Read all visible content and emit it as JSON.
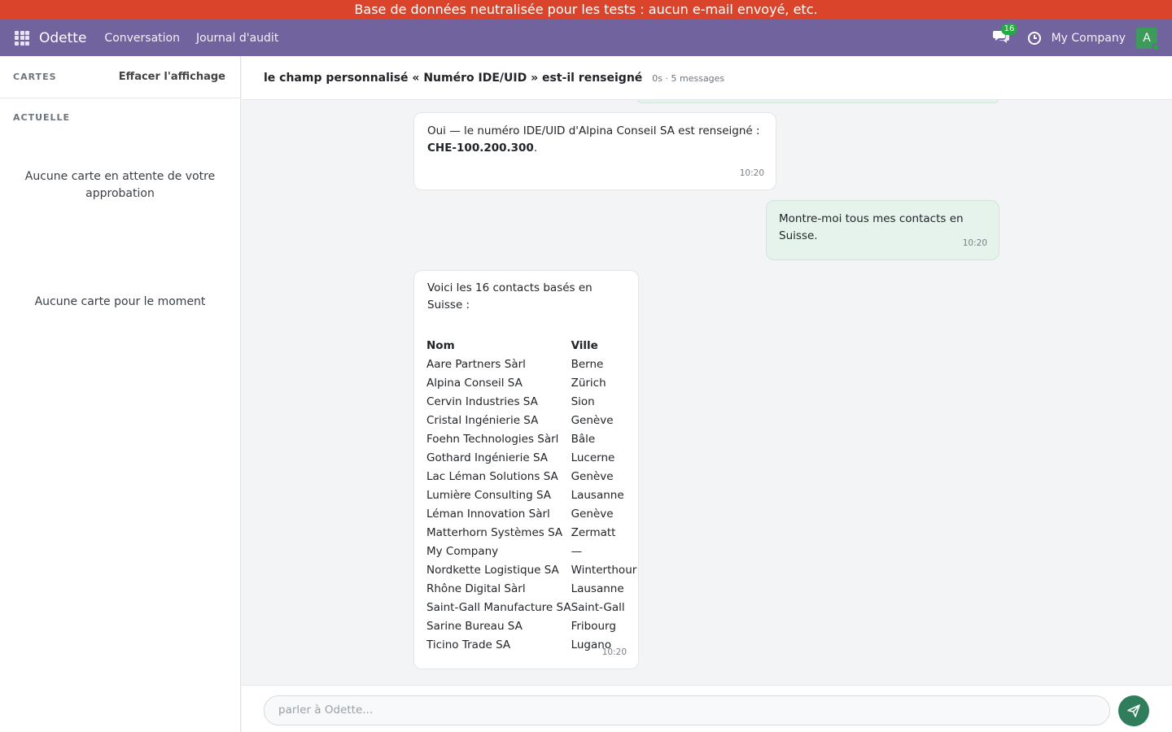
{
  "banner": {
    "text": "Base de données neutralisée pour les tests : aucun e-mail envoyé, etc."
  },
  "navbar": {
    "brand": "Odette",
    "items": [
      "Conversation",
      "Journal d'audit"
    ],
    "messages_count": "16",
    "company": "My Company",
    "avatar_letter": "A"
  },
  "sidebar": {
    "title": "CARTES",
    "clear_label": "Effacer l'affichage",
    "current_label": "ACTUELLE",
    "empty_pending": "Aucune carte en attente de votre approbation",
    "empty_now": "Aucune carte pour le moment"
  },
  "thread": {
    "title": "le champ personnalisé « Numéro IDE/UID » est-il renseigné",
    "meta": "0s · 5 messages"
  },
  "messages": [
    {
      "role": "bot",
      "text_before": "Oui — le numéro IDE/UID d'Alpina Conseil SA est renseigné : ",
      "bold": "CHE-100.200.300",
      "text_after": ".",
      "time": "10:20"
    },
    {
      "role": "user",
      "text": "Montre-moi tous mes contacts en Suisse.",
      "time": "10:20"
    },
    {
      "role": "bot",
      "intro": "Voici les 16 contacts basés en Suisse :",
      "columns": [
        "Nom",
        "Ville"
      ],
      "rows": [
        [
          "Aare Partners Sàrl",
          "Berne"
        ],
        [
          "Alpina Conseil SA",
          "Zürich"
        ],
        [
          "Cervin Industries SA",
          "Sion"
        ],
        [
          "Cristal Ingénierie SA",
          "Genève"
        ],
        [
          "Foehn Technologies Sàrl",
          "Bâle"
        ],
        [
          "Gothard Ingénierie SA",
          "Lucerne"
        ],
        [
          "Lac Léman Solutions SA",
          "Genève"
        ],
        [
          "Lumière Consulting SA",
          "Lausanne"
        ],
        [
          "Léman Innovation Sàrl",
          "Genève"
        ],
        [
          "Matterhorn Systèmes SA",
          "Zermatt"
        ],
        [
          "My Company",
          "—"
        ],
        [
          "Nordkette Logistique SA",
          "Winterthour"
        ],
        [
          "Rhône Digital Sàrl",
          "Lausanne"
        ],
        [
          "Saint-Gall Manufacture SA",
          "Saint-Gall"
        ],
        [
          "Sarine Bureau SA",
          "Fribourg"
        ],
        [
          "Ticino Trade SA",
          "Lugano"
        ]
      ],
      "time": "10:20"
    }
  ],
  "composer": {
    "placeholder": "parler à Odette..."
  },
  "colors": {
    "navbar": "#71639e",
    "banner": "#d9442b",
    "user_bubble": "#e6f2ec",
    "send_button": "#2f7d5b"
  },
  "icons": {
    "apps": "apps-grid-icon",
    "chat": "chat-icon",
    "clock": "clock-icon",
    "send": "send-icon"
  }
}
